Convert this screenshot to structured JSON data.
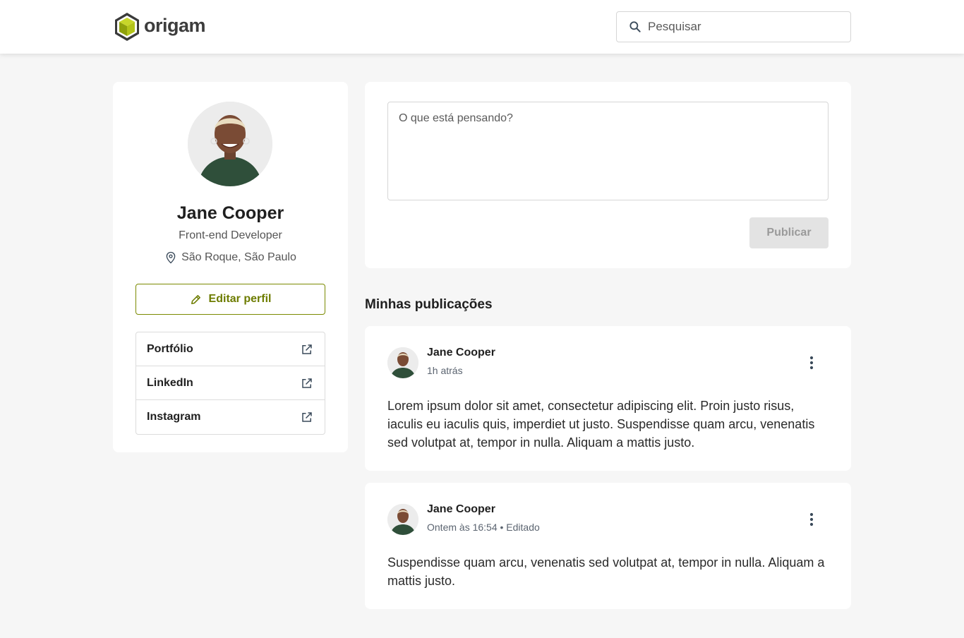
{
  "header": {
    "logo_text": "origam",
    "search_placeholder": "Pesquisar"
  },
  "profile": {
    "name": "Jane Cooper",
    "role": "Front-end Developer",
    "location": "São Roque, São Paulo",
    "edit_label": "Editar perfil",
    "links": [
      {
        "label": "Portfólio",
        "icon": "external-link-icon"
      },
      {
        "label": "LinkedIn",
        "icon": "external-link-icon"
      },
      {
        "label": "Instagram",
        "icon": "external-link-icon"
      }
    ]
  },
  "composer": {
    "placeholder": "O que está pensando?",
    "publish_label": "Publicar"
  },
  "feed": {
    "title": "Minhas publicações",
    "posts": [
      {
        "author": "Jane Cooper",
        "time": "1h atrás",
        "text": "Lorem ipsum dolor sit amet, consectetur adipiscing elit. Proin justo risus, iaculis eu iaculis quis, imperdiet ut justo. Suspendisse quam arcu, venenatis sed volutpat at, tempor in nulla. Aliquam a mattis justo."
      },
      {
        "author": "Jane Cooper",
        "time": "Ontem às 16:54 • Editado",
        "text": "Suspendisse quam arcu, venenatis sed volutpat at, tempor in nulla. Aliquam a mattis justo."
      }
    ]
  },
  "colors": {
    "brand": "#6d7c00",
    "brand_light": "#a4b81c",
    "background": "#f6f6f6",
    "card": "#ffffff"
  }
}
